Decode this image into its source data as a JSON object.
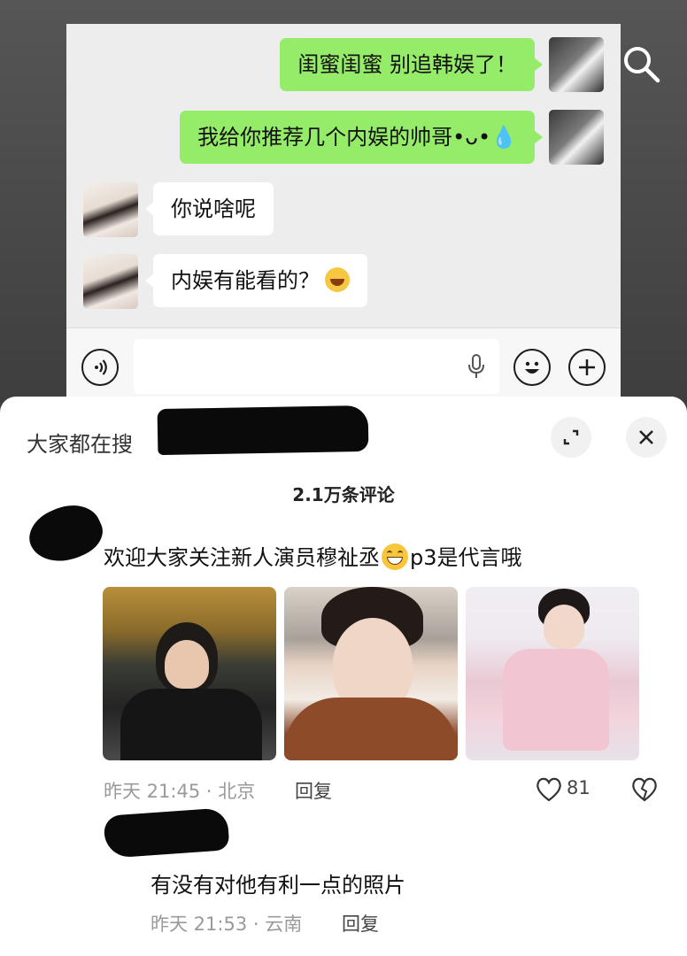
{
  "chat": {
    "messages": [
      {
        "side": "me",
        "text": "闺蜜闺蜜 别追韩娱了！"
      },
      {
        "side": "me",
        "text": "我给你推荐几个内娱的帅哥•ᴗ•💧"
      },
      {
        "side": "other",
        "text": "你说啥呢"
      },
      {
        "side": "other",
        "text": "内娱有能看的？"
      }
    ],
    "input": {
      "placeholder": ""
    }
  },
  "sheet": {
    "search_hint": "大家都在搜",
    "comment_count": "2.1万条评论",
    "comments": [
      {
        "text_before": "欢迎大家关注新人演员穆祉丞",
        "text_after": "p3是代言哦",
        "time": "昨天 21:45 · 北京",
        "reply_label": "回复",
        "likes": "81"
      },
      {
        "text": "有没有对他有利一点的照片",
        "time": "昨天 21:53 · 云南",
        "reply_label": "回复"
      }
    ]
  },
  "icons": [
    "search-icon",
    "voice-icon",
    "mic-icon",
    "emoji-icon",
    "plus-icon",
    "expand-icon",
    "close-icon",
    "heart-icon",
    "broken-heart-icon"
  ]
}
